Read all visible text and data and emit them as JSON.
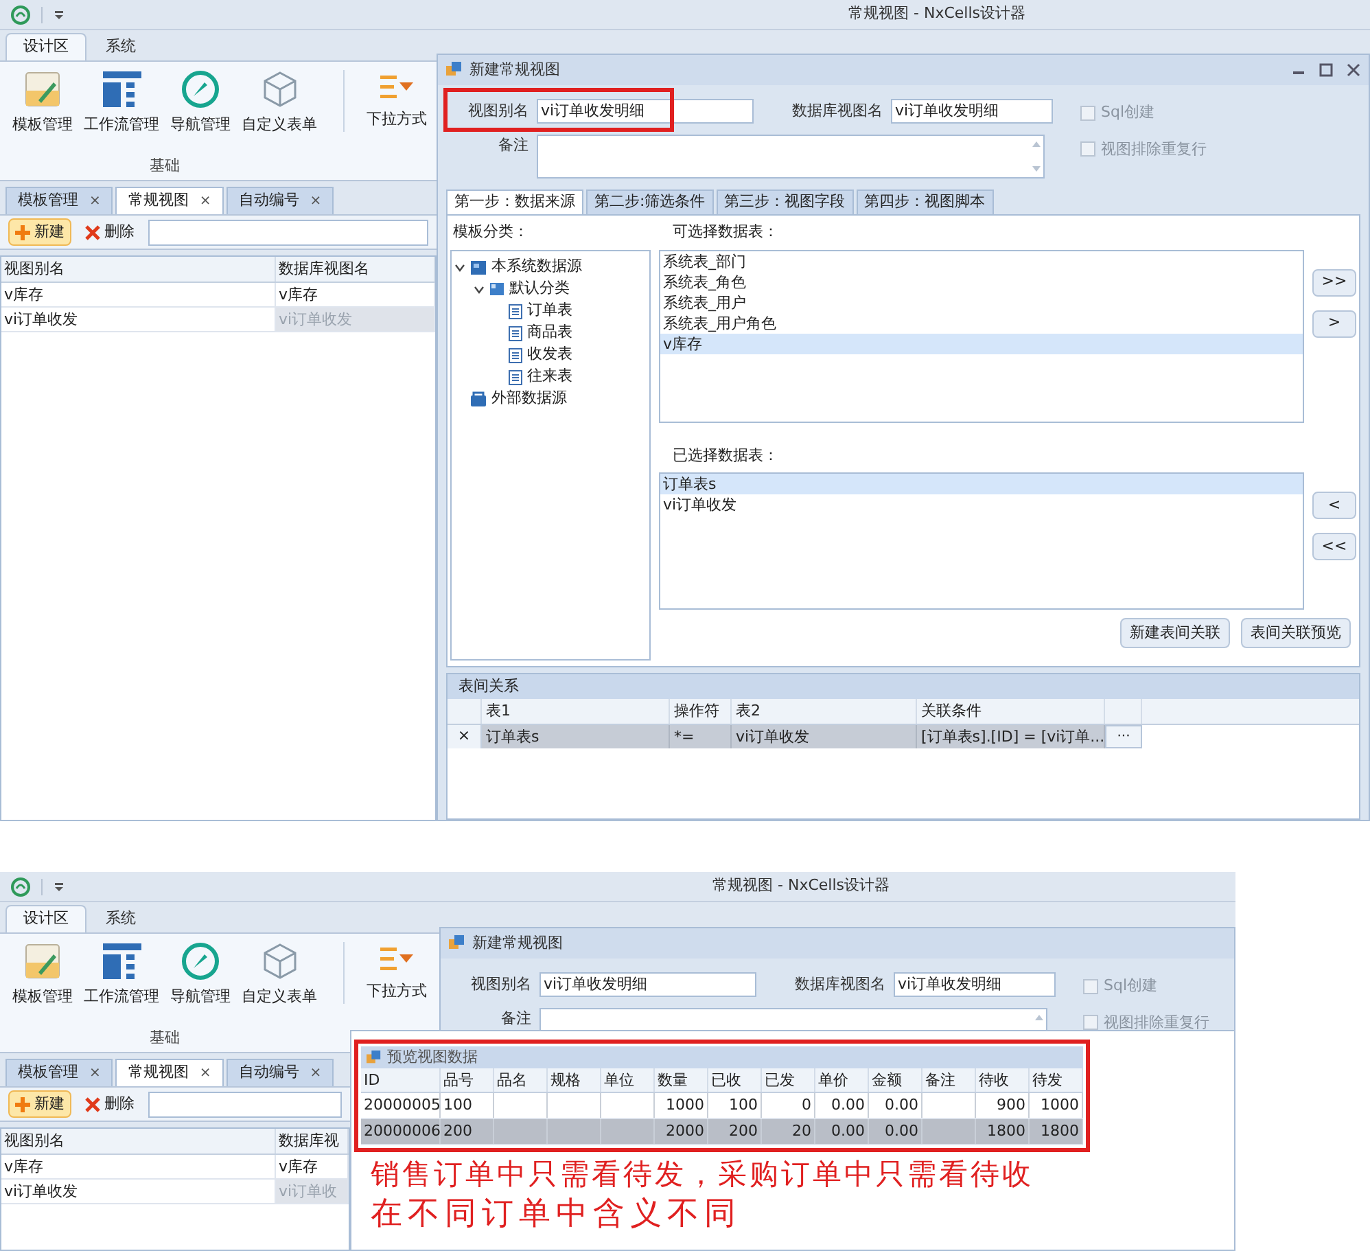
{
  "screens": [
    {
      "title": "常规视图 - NxCells设计器",
      "ribbon_tabs": [
        {
          "label": "设计区",
          "selected": true
        },
        {
          "label": "系统",
          "selected": false
        }
      ],
      "ribbon_buttons": [
        {
          "label": "模板管理",
          "kind": "template"
        },
        {
          "label": "工作流管理",
          "kind": "workflow"
        },
        {
          "label": "导航管理",
          "kind": "compass"
        },
        {
          "label": "自定义表单",
          "kind": "cube"
        },
        {
          "label": "下拉方式",
          "kind": "dropdown"
        }
      ],
      "ribbon_group": "基础",
      "doc_tabs": [
        {
          "label": "模板管理",
          "close": "×",
          "selected": false
        },
        {
          "label": "常规视图",
          "close": "×",
          "selected": true
        },
        {
          "label": "自动编号",
          "close": "×",
          "selected": false
        }
      ],
      "toolbar": [
        {
          "label": "新建",
          "kind": "plus"
        },
        {
          "label": "删除",
          "kind": "delete"
        }
      ],
      "grid": {
        "columns": [
          "视图别名",
          "数据库视图名"
        ],
        "rows": [
          {
            "cells": [
              "v库存",
              "v库存"
            ],
            "selected": false
          },
          {
            "cells": [
              "vi订单收发",
              "vi订单收发"
            ],
            "selected": true
          }
        ]
      },
      "dialog": {
        "title": "新建常规视图",
        "alias": {
          "label": "视图别名",
          "value": "vi订单收发明细",
          "highlighted": true
        },
        "db_name": {
          "label": "数据库视图名",
          "value": "vi订单收发明细"
        },
        "checkboxes": [
          {
            "label": "Sql创建",
            "checked": false
          },
          {
            "label": "视图排除重复行",
            "checked": false
          }
        ],
        "remark": {
          "label": "备注"
        },
        "steps": [
          {
            "label": "第一步：数据来源",
            "selected": true
          },
          {
            "label": "第二步:筛选条件",
            "selected": false
          },
          {
            "label": "第三步：视图字段",
            "selected": false
          },
          {
            "label": "第四步：视图脚本",
            "selected": false
          }
        ],
        "category_label": "模板分类：",
        "tree": [
          {
            "label": "本系统数据源",
            "kind": "source",
            "expanded": true,
            "children": [
              {
                "label": "默认分类",
                "kind": "category",
                "expanded": true,
                "children": [
                  {
                    "label": "订单表",
                    "kind": "table"
                  },
                  {
                    "label": "商品表",
                    "kind": "table"
                  },
                  {
                    "label": "收发表",
                    "kind": "table"
                  },
                  {
                    "label": "往来表",
                    "kind": "table"
                  }
                ]
              }
            ]
          },
          {
            "label": "外部数据源",
            "kind": "external"
          }
        ],
        "available": {
          "label": "可选择数据表：",
          "items": [
            {
              "label": "系统表_部门",
              "selected": false
            },
            {
              "label": "系统表_角色",
              "selected": false
            },
            {
              "label": "系统表_用户",
              "selected": false
            },
            {
              "label": "系统表_用户角色",
              "selected": false
            },
            {
              "label": "v库存",
              "selected": true
            }
          ]
        },
        "move_right": [
          ">>",
          ">"
        ],
        "selected_tables": {
          "label": "已选择数据表：",
          "items": [
            {
              "label": "订单表s",
              "selected": true
            },
            {
              "label": "vi订单收发",
              "selected": false
            }
          ]
        },
        "move_left": [
          "<",
          "<<"
        ],
        "actions": [
          "新建表间关联",
          "表间关联预览"
        ],
        "relations": {
          "title": "表间关系",
          "columns": [
            "表1",
            "操作符",
            "表2",
            "关联条件"
          ],
          "rows": [
            {
              "remove": "×",
              "cells": [
                "订单表s",
                "*=",
                "vi订单收发",
                "[订单表s].[ID] = [vi订单..."
              ],
              "more": "···",
              "selected": true
            }
          ]
        }
      }
    },
    {
      "title": "常规视图 - NxCells设计器",
      "ribbon_tabs": [
        {
          "label": "设计区",
          "selected": true
        },
        {
          "label": "系统",
          "selected": false
        }
      ],
      "ribbon_buttons": [
        {
          "label": "模板管理",
          "kind": "template"
        },
        {
          "label": "工作流管理",
          "kind": "workflow"
        },
        {
          "label": "导航管理",
          "kind": "compass"
        },
        {
          "label": "自定义表单",
          "kind": "cube"
        },
        {
          "label": "下拉方式",
          "kind": "dropdown"
        }
      ],
      "ribbon_group": "基础",
      "doc_tabs": [
        {
          "label": "模板管理",
          "close": "×",
          "selected": false
        },
        {
          "label": "常规视图",
          "close": "×",
          "selected": true
        },
        {
          "label": "自动编号",
          "close": "×",
          "selected": false
        }
      ],
      "toolbar": [
        {
          "label": "新建",
          "kind": "plus"
        },
        {
          "label": "删除",
          "kind": "delete"
        }
      ],
      "grid": {
        "columns": [
          "视图别名",
          "数据库视"
        ],
        "rows": [
          {
            "cells": [
              "v库存",
              "v库存"
            ],
            "selected": false
          },
          {
            "cells": [
              "vi订单收发",
              "vi订单收"
            ],
            "selected": true
          }
        ]
      },
      "dialog": {
        "title": "新建常规视图",
        "alias": {
          "label": "视图别名",
          "value": "vi订单收发明细"
        },
        "db_name": {
          "label": "数据库视图名",
          "value": "vi订单收发明细"
        },
        "checkboxes": [
          {
            "label": "Sql创建",
            "checked": false
          },
          {
            "label": "视图排除重复行",
            "checked": false
          }
        ],
        "remark": {
          "label": "备注"
        }
      },
      "preview": {
        "title": "预览视图数据",
        "highlighted": true,
        "columns": [
          {
            "label": "ID",
            "kind": "text"
          },
          {
            "label": "品号",
            "kind": "text"
          },
          {
            "label": "品名"
          },
          {
            "label": "规格"
          },
          {
            "label": "单位"
          },
          {
            "label": "数量",
            "kind": "number"
          },
          {
            "label": "已收",
            "kind": "number"
          },
          {
            "label": "已发",
            "kind": "number"
          },
          {
            "label": "单价",
            "kind": "number"
          },
          {
            "label": "金额",
            "kind": "number"
          },
          {
            "label": "备注"
          },
          {
            "label": "待收",
            "kind": "number"
          },
          {
            "label": "待发",
            "kind": "number"
          }
        ],
        "rows": [
          {
            "cells": [
              "20000005",
              "100",
              null,
              null,
              null,
              "1000",
              "100",
              "0",
              "0.00",
              "0.00",
              null,
              "900",
              "1000"
            ],
            "selected": false
          },
          {
            "cells": [
              "20000006",
              "200",
              null,
              null,
              null,
              "2000",
              "200",
              "20",
              "0.00",
              "0.00",
              null,
              "1800",
              "1800"
            ],
            "selected": true
          }
        ]
      },
      "annotation": [
        "销售订单中只需看待发，采购订单中只需看待收",
        "在不同订单中含义不同"
      ]
    }
  ]
}
